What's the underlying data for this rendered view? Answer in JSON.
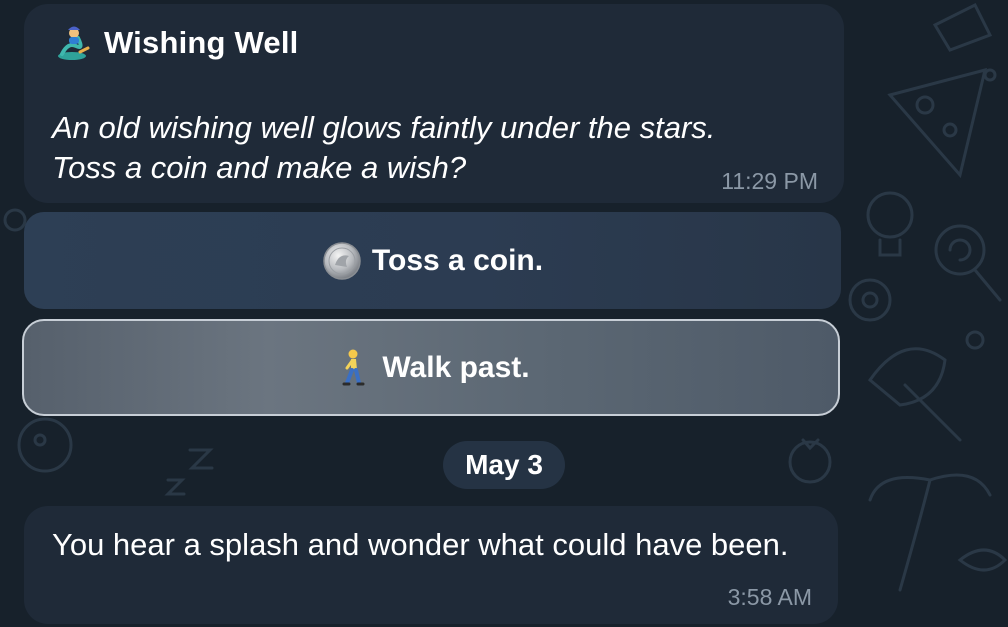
{
  "message1": {
    "title": "Wishing Well",
    "title_icon": "genie-icon",
    "body": "An old wishing well glows faintly under the stars.\nToss a coin and make a wish?",
    "time": "11:29 PM"
  },
  "keyboard": {
    "buttons": [
      {
        "icon": "coin-icon",
        "label": "Toss a coin."
      },
      {
        "icon": "walking-person-icon",
        "label": "Walk past."
      }
    ]
  },
  "date_separator": "May 3",
  "message2": {
    "body": "You hear a splash and wonder what could have been.",
    "time": "3:58 AM"
  },
  "colors": {
    "background": "#17212b",
    "bubble": "#1f2a38",
    "button": "#2c3c52",
    "button_selected": "#5b6773",
    "timestamp": "#8b98a6"
  }
}
